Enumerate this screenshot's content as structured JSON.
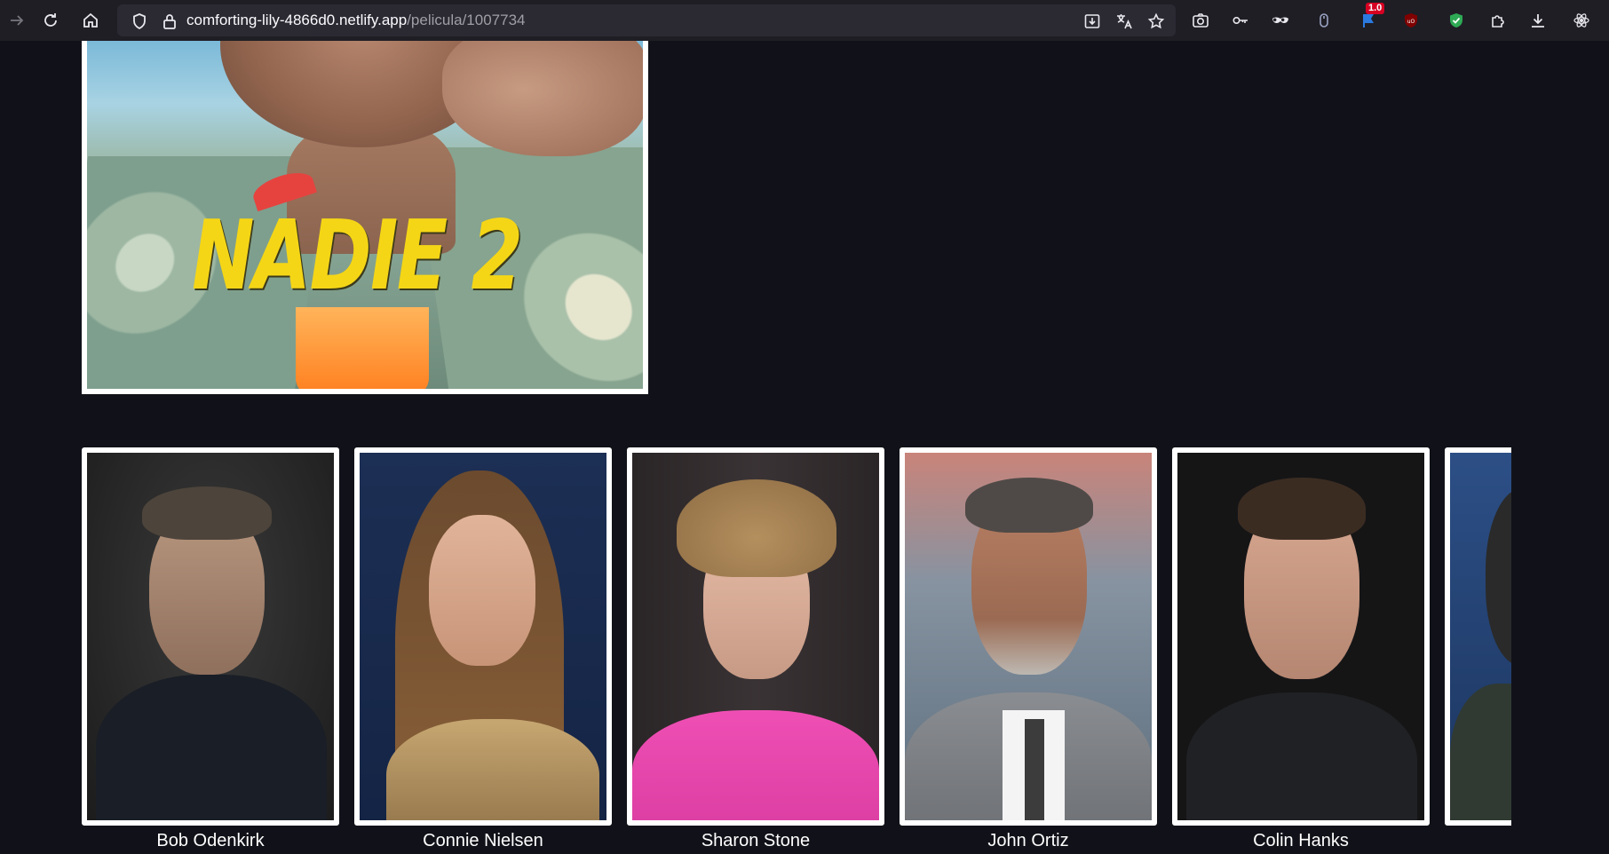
{
  "browser": {
    "url_host": "comforting-lily-4866d0.netlify.app",
    "url_path": "/pelicula/1007734",
    "extension_badge": "1.0",
    "icons": [
      "forward-icon",
      "reload-icon",
      "home-icon",
      "shield-icon",
      "lock-icon",
      "install-icon",
      "translate-icon",
      "bookmark-star-icon",
      "screenshot-icon",
      "key-icon",
      "mask-icon",
      "mouse-extension-icon",
      "flag-extension-icon",
      "ublock-icon",
      "shield-check-extension-icon",
      "extensions-puzzle-icon",
      "downloads-icon",
      "react-icon"
    ]
  },
  "movie": {
    "poster_title": "NADIE 2"
  },
  "cast": [
    {
      "name": "Bob Odenkirk"
    },
    {
      "name": "Connie Nielsen"
    },
    {
      "name": "Sharon Stone"
    },
    {
      "name": "John Ortiz"
    },
    {
      "name": "Colin Hanks"
    }
  ],
  "colors": {
    "page_bg": "#111219",
    "toolbar_bg": "#1f1e25",
    "urlbar_bg": "#2b2a33",
    "card_border": "#ffffff",
    "poster_title": "#f5d616"
  }
}
